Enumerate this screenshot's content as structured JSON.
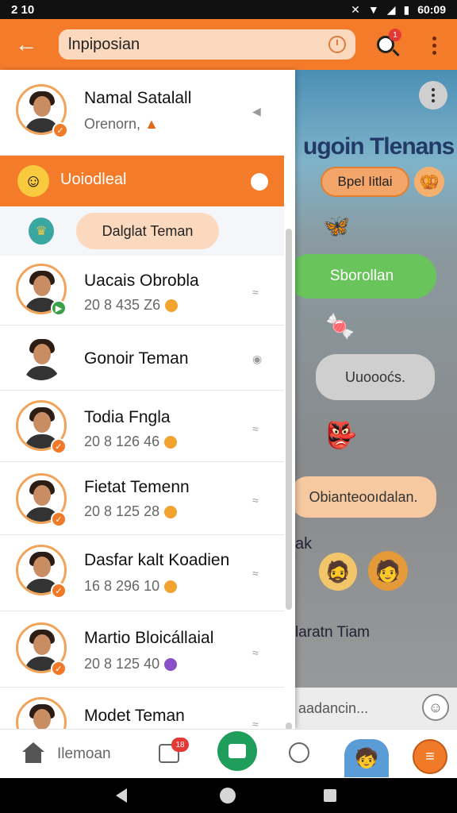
{
  "status_bar": {
    "time_left": "2 10",
    "time_right": "60:09",
    "icons": [
      "notification-icon",
      "wifi-icon",
      "signal-icon",
      "battery-icon"
    ]
  },
  "app_bar": {
    "search_value": "lnpiposian",
    "search_badge": "1",
    "accent_color": "#f47b2a"
  },
  "contacts": [
    {
      "name": "Namal Satalall",
      "subtitle": "Orenorn,"
    },
    {
      "name": "Uacais Obrobla",
      "subtitle": "20 8 435 Z6"
    },
    {
      "name": "Gonoir Teman",
      "subtitle": ""
    },
    {
      "name": "Todia Fngla",
      "subtitle": "20 8 126 46"
    },
    {
      "name": "Fietat Temenn",
      "subtitle": "20 8 125 28"
    },
    {
      "name": "Dasfar kalt Koadien",
      "subtitle": "16 8 296 10"
    },
    {
      "name": "Martio Bloicállaial",
      "subtitle": "20 8 125 40"
    },
    {
      "name": "Modet Teman",
      "subtitle": ""
    }
  ],
  "group_row": {
    "label": "Uoiodleal"
  },
  "add_friend": {
    "label": "Dalglat Teman"
  },
  "game_panel": {
    "title": "ugoin Tlenans",
    "chip_label": "Bpel Iitlai",
    "green_button": "Sborollan",
    "grey_pill": "Uuoooćs.",
    "peach_banner": "Obianteooıdalan.",
    "label_ak": "ak",
    "label_team": "laratn Tiam",
    "chat_placeholder": "aadancin..."
  },
  "bottom_nav": {
    "home_label": "Ilemoan",
    "chat_badge": "18"
  }
}
